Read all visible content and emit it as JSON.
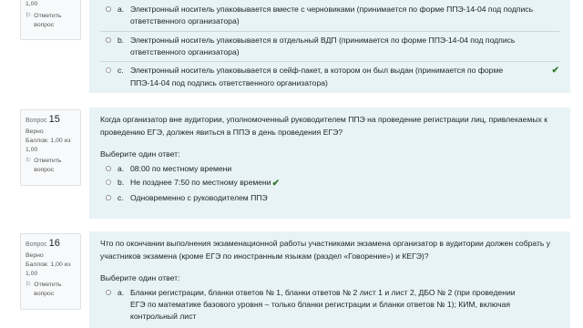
{
  "q14": {
    "score": "1,00",
    "flag_label": "Отметить вопрос",
    "answers": [
      {
        "letter": "a.",
        "text": "Электронный носитель упаковывается вместе с черновиками (принимается по форме ППЭ-14-04 под подпись ответственного организатора)",
        "selected": false,
        "correct": false
      },
      {
        "letter": "b.",
        "text": "Электронный носитель упаковывается в отдельный ВДП (принимается по форме ППЭ-14-04 под подпись ответственного организатора)",
        "selected": false,
        "correct": false
      },
      {
        "letter": "c.",
        "text": "Электронный носитель упаковывается в сейф-пакет, в котором он был выдан (принимается по форме ППЭ-14-04 под подпись ответственного организатора)",
        "selected": true,
        "correct": true
      }
    ]
  },
  "q15": {
    "label": "Вопрос",
    "number": "15",
    "status": "Верно",
    "score": "Баллов: 1,00 из 1,00",
    "flag_label": "Отметить вопрос",
    "text": "Когда организатор вне аудитории, уполномоченный руководителем ППЭ на проведение регистрации лиц, привлекаемых к проведению ЕГЭ, должен явиться в ППЭ в день проведения ЕГЭ?",
    "prompt": "Выберите один ответ:",
    "answers": [
      {
        "letter": "a.",
        "text": "08:00 по местному времени",
        "selected": false,
        "correct": false
      },
      {
        "letter": "b.",
        "text": "Не позднее 7:50 по местному времени",
        "selected": true,
        "correct": true
      },
      {
        "letter": "c.",
        "text": "Одновременно с руководителем ППЭ",
        "selected": false,
        "correct": false
      }
    ]
  },
  "q16": {
    "label": "Вопрос",
    "number": "16",
    "status": "Верно",
    "score": "Баллов: 1,00 из 1,00",
    "flag_label": "Отметить вопрос",
    "text": "Что по окончании выполнения экзаменационной работы участниками экзамена организатор в аудитории должен собрать у участников экзамена (кроме ЕГЭ по иностранным языкам (раздел «Говорение») и КЕГЭ)?",
    "prompt": "Выберите один ответ:",
    "answers": [
      {
        "letter": "a.",
        "text": "Бланки регистрации, бланки ответов № 1, бланки ответов № 2 лист 1 и лист 2, ДБО № 2 (при проведении ЕГЭ по математике базового уровня – только бланки регистрации и бланки ответов № 1); КИМ, включая контрольный лист",
        "selected": false,
        "correct": false
      }
    ]
  },
  "icons": {
    "flag": "flag-icon",
    "check": "checkmark-icon"
  },
  "colors": {
    "content_bg": "#e7f3f5",
    "correct": "#357a32"
  }
}
